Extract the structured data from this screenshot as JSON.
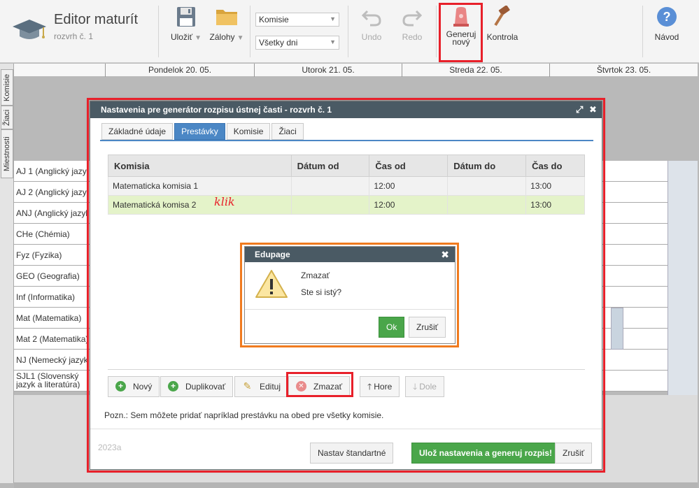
{
  "app": {
    "title": "Editor maturít",
    "subtitle": "rozvrh č. 1"
  },
  "toolbar": {
    "save": "Uložiť",
    "backups": "Zálohy",
    "select_committee": "Komisie",
    "select_days": "Všetky dni",
    "undo": "Undo",
    "redo": "Redo",
    "generate_line1": "Generuj",
    "generate_line2": "nový",
    "check": "Kontrola",
    "help": "Návod"
  },
  "timetable": {
    "days": [
      "Pondelok 20. 05.",
      "Utorok 21. 05.",
      "Streda 22. 05.",
      "Štvrtok 23. 05."
    ],
    "side_tabs": [
      "Komisie",
      "Žiaci",
      "Miestnosti"
    ],
    "rows": [
      "AJ 1 (Anglický jazyk)",
      "AJ 2 (Anglický jazyk)",
      "ANJ (Anglický jazyk)",
      "CHe (Chémia)",
      "Fyz (Fyzika)",
      "GEO (Geografia)",
      "Inf (Informatika)",
      "Mat (Matematika)",
      "Mat 2 (Matematika)",
      "NJ (Nemecký jazyk)",
      "SJL1 (Slovenský jazyk a literatúra)"
    ]
  },
  "dialog": {
    "title": "Nastavenia pre generátor rozpisu ústnej časti - rozvrh č. 1",
    "tabs": [
      "Základné údaje",
      "Prestávky",
      "Komisie",
      "Žiaci"
    ],
    "active_tab": "Prestávky",
    "columns": [
      "Komisia",
      "Dátum od",
      "Čas od",
      "Dátum do",
      "Čas do"
    ],
    "rows": [
      {
        "komisia": "Matematicka komisia 1",
        "datum_od": "",
        "cas_od": "12:00",
        "datum_do": "",
        "cas_do": "13:00"
      },
      {
        "komisia": "Matematická komisa 2",
        "datum_od": "",
        "cas_od": "12:00",
        "datum_do": "",
        "cas_do": "13:00"
      }
    ],
    "annotation": "klik",
    "actions": {
      "new": "Nový",
      "duplicate": "Duplikovať",
      "edit": "Edituj",
      "delete": "Zmazať",
      "up": "Hore",
      "down": "Dole"
    },
    "note": "Pozn.: Sem môžete pridať napríklad prestávku na obed pre všetky komisie.",
    "version": "2023a",
    "footer": {
      "default": "Nastav štandartné",
      "save_generate": "Ulož nastavenia a generuj rozpis!",
      "cancel": "Zrušiť"
    }
  },
  "confirm": {
    "title": "Edupage",
    "line1": "Zmazať",
    "line2": "Ste si istý?",
    "ok": "Ok",
    "cancel": "Zrušiť"
  },
  "colors": {
    "accent_blue": "#4b87c5",
    "header_dark": "#4a5a64",
    "green": "#4aa64a",
    "highlight_row": "#e4f3c9",
    "annotation_red": "#e8202a",
    "annotation_orange": "#f07b1f"
  }
}
